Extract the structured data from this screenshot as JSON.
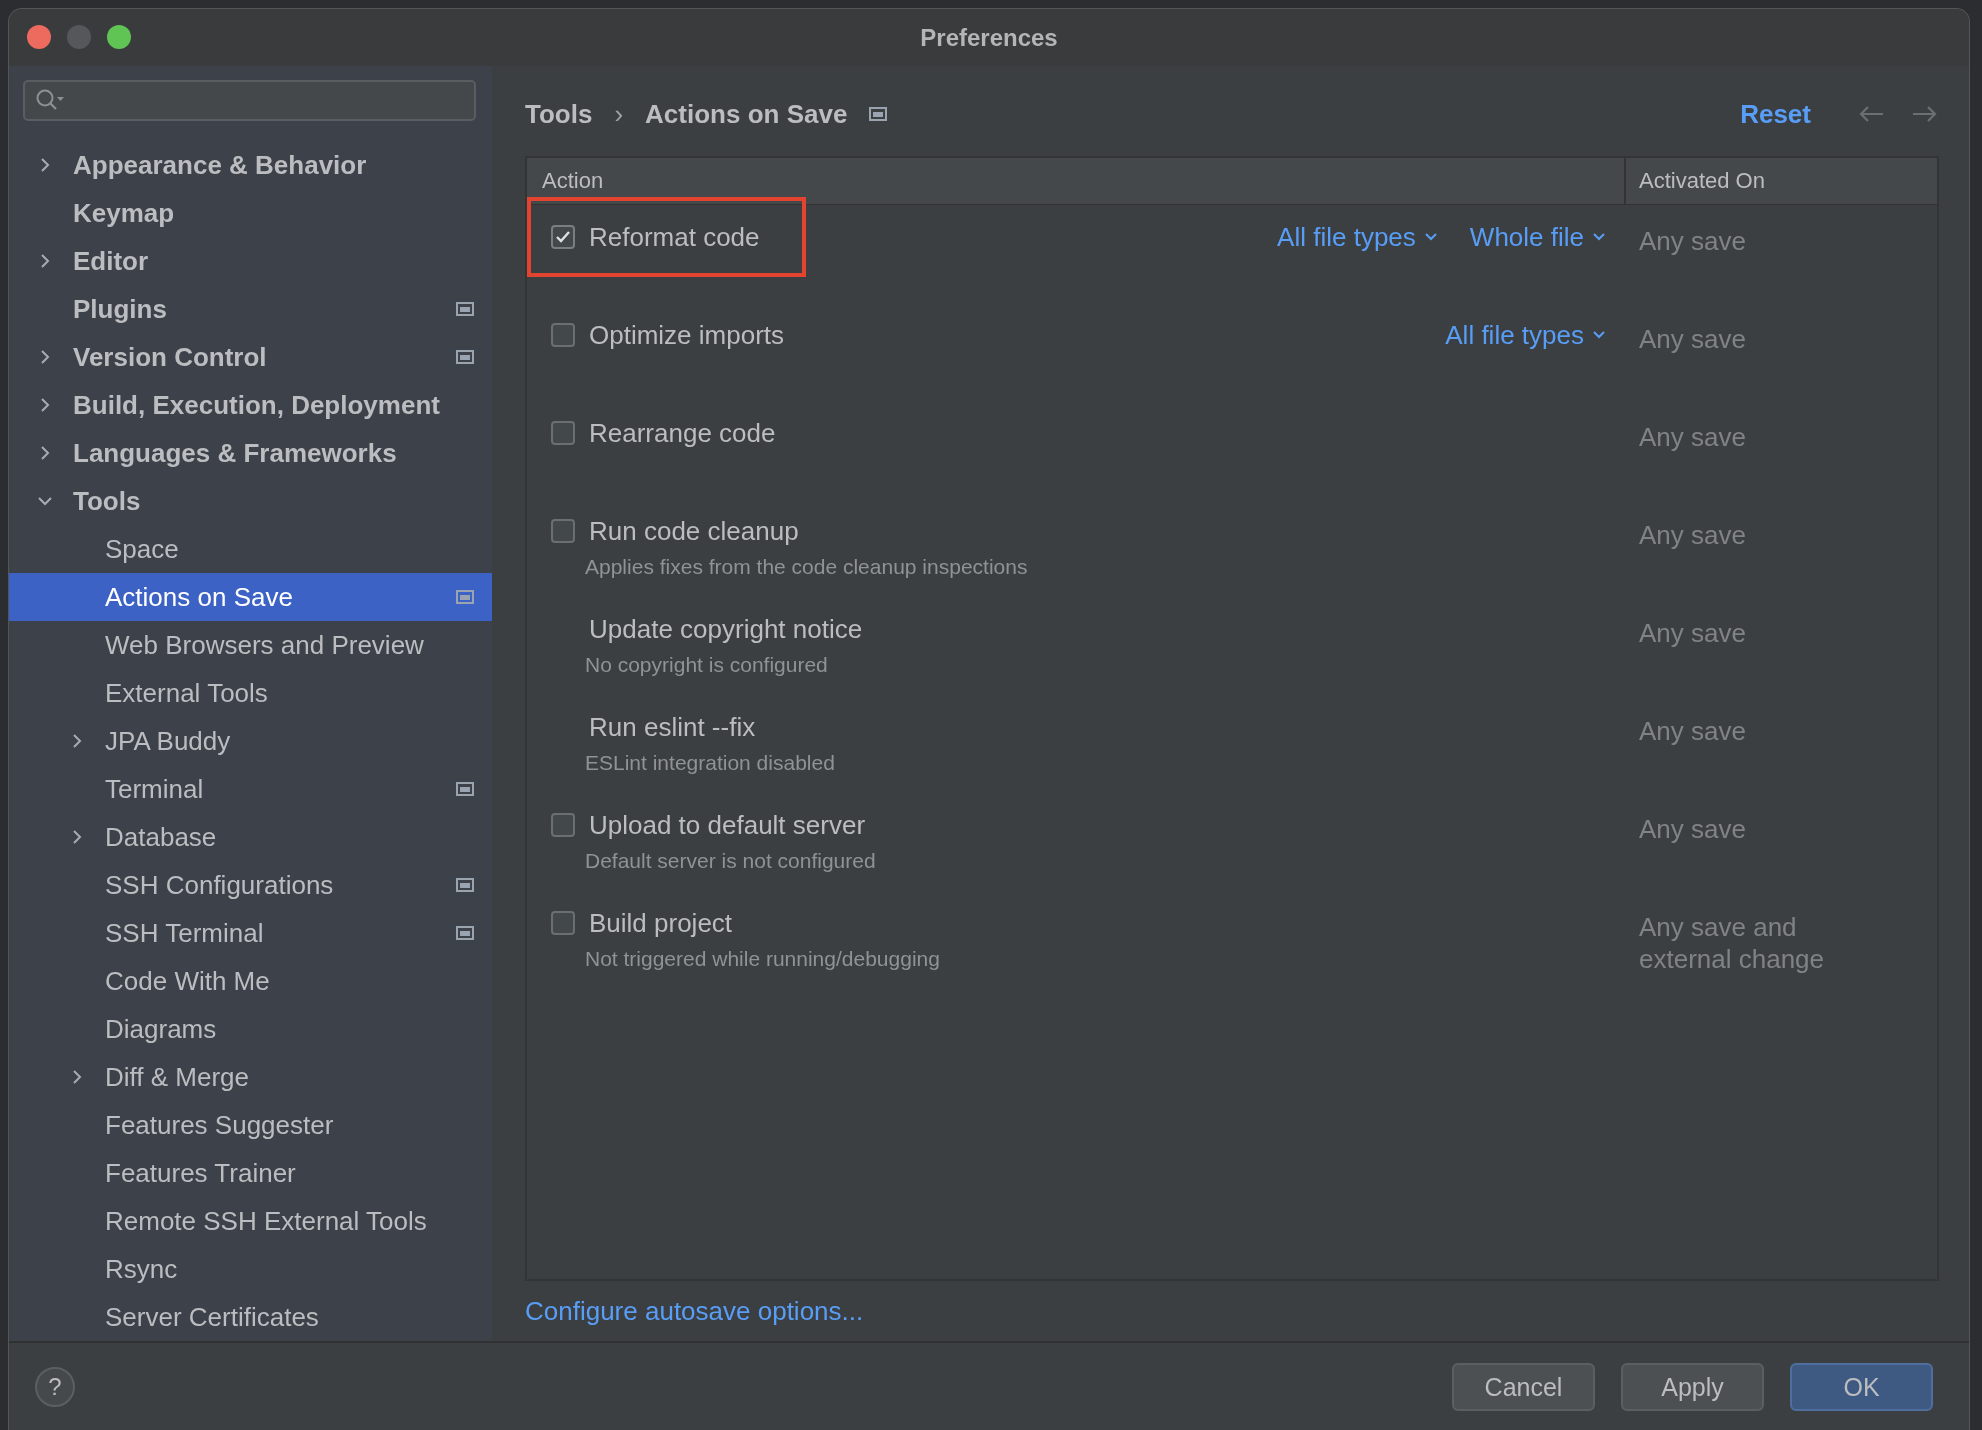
{
  "window": {
    "title": "Preferences"
  },
  "sidebar": {
    "items": [
      {
        "label": "Appearance & Behavior",
        "bold": true,
        "expanded": false,
        "selected": false,
        "project_scope": false
      },
      {
        "label": "Keymap",
        "bold": true,
        "selected": false,
        "project_scope": false
      },
      {
        "label": "Editor",
        "bold": true,
        "expanded": false,
        "selected": false,
        "project_scope": false
      },
      {
        "label": "Plugins",
        "bold": true,
        "selected": false,
        "project_scope": true
      },
      {
        "label": "Version Control",
        "bold": true,
        "expanded": false,
        "selected": false,
        "project_scope": true
      },
      {
        "label": "Build, Execution, Deployment",
        "bold": true,
        "expanded": false,
        "selected": false,
        "project_scope": false
      },
      {
        "label": "Languages & Frameworks",
        "bold": true,
        "expanded": false,
        "selected": false,
        "project_scope": false
      },
      {
        "label": "Tools",
        "bold": true,
        "expanded": true,
        "selected": false,
        "project_scope": false,
        "children": [
          {
            "label": "Space",
            "bold": false,
            "selected": false,
            "project_scope": false
          },
          {
            "label": "Actions on Save",
            "bold": false,
            "selected": true,
            "project_scope": true
          },
          {
            "label": "Web Browsers and Preview",
            "bold": false,
            "selected": false,
            "project_scope": false
          },
          {
            "label": "External Tools",
            "bold": false,
            "selected": false,
            "project_scope": false
          },
          {
            "label": "JPA Buddy",
            "bold": false,
            "expanded": false,
            "selected": false,
            "project_scope": false
          },
          {
            "label": "Terminal",
            "bold": false,
            "selected": false,
            "project_scope": true
          },
          {
            "label": "Database",
            "bold": false,
            "expanded": false,
            "selected": false,
            "project_scope": false
          },
          {
            "label": "SSH Configurations",
            "bold": false,
            "selected": false,
            "project_scope": true
          },
          {
            "label": "SSH Terminal",
            "bold": false,
            "selected": false,
            "project_scope": true
          },
          {
            "label": "Code With Me",
            "bold": false,
            "selected": false,
            "project_scope": false
          },
          {
            "label": "Diagrams",
            "bold": false,
            "selected": false,
            "project_scope": false
          },
          {
            "label": "Diff & Merge",
            "bold": false,
            "expanded": false,
            "selected": false,
            "project_scope": false
          },
          {
            "label": "Features Suggester",
            "bold": false,
            "selected": false,
            "project_scope": false
          },
          {
            "label": "Features Trainer",
            "bold": false,
            "selected": false,
            "project_scope": false
          },
          {
            "label": "Remote SSH External Tools",
            "bold": false,
            "selected": false,
            "project_scope": false
          },
          {
            "label": "Rsync",
            "bold": false,
            "selected": false,
            "project_scope": false
          },
          {
            "label": "Server Certificates",
            "bold": false,
            "selected": false,
            "project_scope": false
          }
        ]
      }
    ]
  },
  "breadcrumb": {
    "items": [
      "Tools",
      "Actions on Save"
    ],
    "separator": "›",
    "project_scope": true
  },
  "reset": "Reset",
  "table": {
    "columns": [
      "Action",
      "Activated On"
    ],
    "rows": [
      {
        "kind": "checkbox",
        "label": "Reformat code",
        "checked": true,
        "highlighted": true,
        "selectors": [
          "All file types",
          "Whole file"
        ],
        "activated_on": "Any save"
      },
      {
        "kind": "checkbox",
        "label": "Optimize imports",
        "checked": false,
        "highlighted": false,
        "selectors": [
          "All file types"
        ],
        "activated_on": "Any save"
      },
      {
        "kind": "checkbox",
        "label": "Rearrange code",
        "checked": false,
        "highlighted": false,
        "activated_on": "Any save"
      },
      {
        "kind": "checkbox",
        "label": "Run code cleanup",
        "sublabel": "Applies fixes from the code cleanup inspections",
        "checked": false,
        "highlighted": false,
        "activated_on": "Any save"
      },
      {
        "kind": "plain",
        "label": "Update copyright notice",
        "sublabel": "No copyright is configured",
        "highlighted": false,
        "activated_on": "Any save"
      },
      {
        "kind": "plain",
        "label": "Run eslint --fix",
        "sublabel": "ESLint integration disabled",
        "highlighted": false,
        "activated_on": "Any save"
      },
      {
        "kind": "checkbox",
        "label": "Upload to default server",
        "sublabel": "Default server is not configured",
        "checked": false,
        "highlighted": false,
        "activated_on": "Any save"
      },
      {
        "kind": "checkbox",
        "label": "Build project",
        "sublabel": "Not triggered while running/debugging",
        "checked": false,
        "highlighted": false,
        "activated_on": "Any save and external change"
      }
    ]
  },
  "link": "Configure autosave options...",
  "help": "?",
  "buttons": [
    {
      "label": "Cancel",
      "default": false
    },
    {
      "label": "Apply",
      "default": false
    },
    {
      "label": "OK",
      "default": true
    }
  ]
}
